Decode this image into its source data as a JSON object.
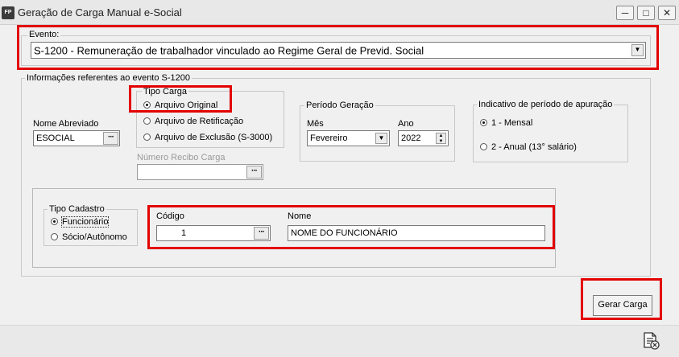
{
  "window": {
    "app_icon": "FP",
    "title": "Geração de Carga Manual e-Social",
    "controls": [
      "minimize",
      "maximize",
      "close"
    ]
  },
  "evento": {
    "label": "Evento:",
    "selected": "S-1200 - Remuneração de trabalhador vinculado ao Regime Geral de Previd. Social"
  },
  "info": {
    "label": "Informações referentes ao evento S-1200",
    "nome_abreviado": {
      "label": "Nome Abreviado",
      "value": "ESOCIAL"
    },
    "tipo_carga": {
      "label": "Tipo Carga",
      "options": [
        {
          "label": "Arquivo Original",
          "selected": true
        },
        {
          "label": "Arquivo de Retificação",
          "selected": false
        },
        {
          "label": "Arquivo de Exclusão (S-3000)",
          "selected": false
        }
      ]
    },
    "numero_recibo": {
      "label": "Número Recibo Carga",
      "value": ""
    },
    "periodo": {
      "label": "Período Geração",
      "mes_label": "Mês",
      "mes_value": "Fevereiro",
      "ano_label": "Ano",
      "ano_value": "2022"
    },
    "indicativo": {
      "label": "Indicativo de período de apuração",
      "options": [
        {
          "label": "1 - Mensal",
          "selected": true
        },
        {
          "label": "2 - Anual (13° salário)",
          "selected": false
        }
      ]
    }
  },
  "cadastro": {
    "tipo_label": "Tipo Cadastro",
    "options": [
      {
        "label": "Funcionário",
        "selected": true
      },
      {
        "label": "Sócio/Autônomo",
        "selected": false
      }
    ],
    "codigo_label": "Código",
    "codigo_value": "1",
    "nome_label": "Nome",
    "nome_value": "NOME DO FUNCIONÁRIO"
  },
  "actions": {
    "gerar_label": "Gerar Carga",
    "footer_icon": "clear-document-icon"
  },
  "colors": {
    "highlight": "#e30000",
    "background": "#f0f0f0"
  }
}
